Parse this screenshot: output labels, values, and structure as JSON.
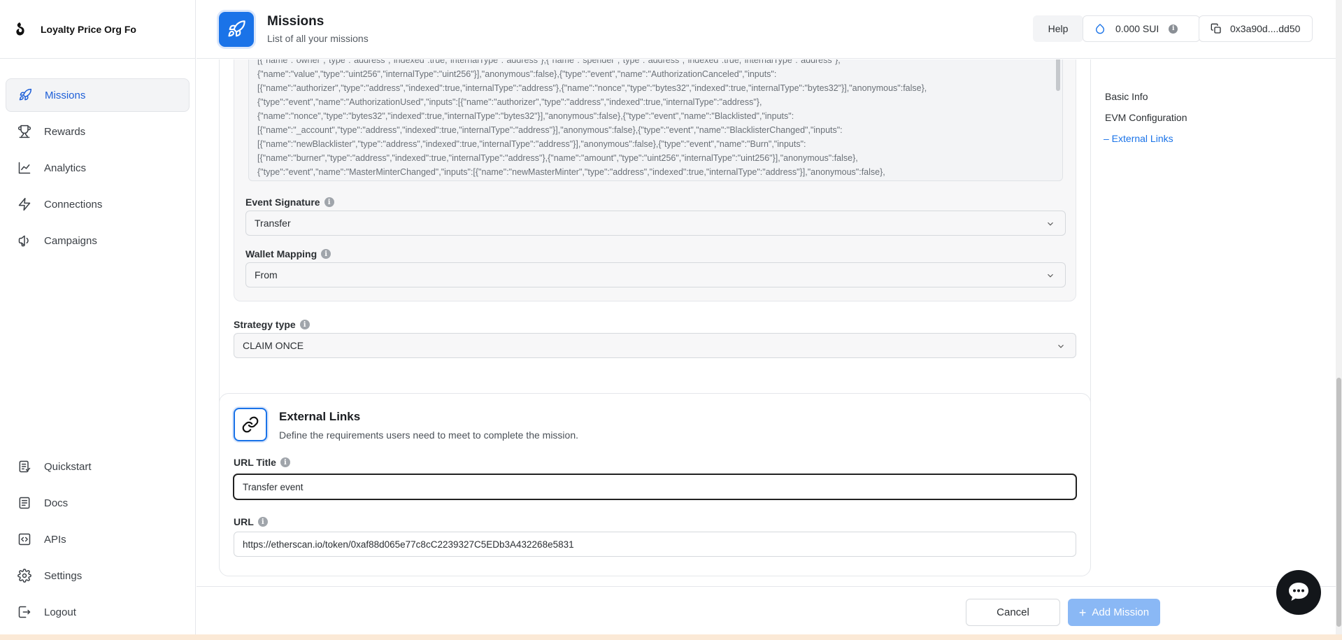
{
  "brand": {
    "name": "Loyalty Price Org Fo"
  },
  "nav": {
    "items": [
      {
        "label": "Missions",
        "icon": "rocket-icon",
        "active": true
      },
      {
        "label": "Rewards",
        "icon": "trophy-icon"
      },
      {
        "label": "Analytics",
        "icon": "chart-line-icon"
      },
      {
        "label": "Connections",
        "icon": "lightning-icon"
      },
      {
        "label": "Campaigns",
        "icon": "megaphone-icon"
      }
    ],
    "bottom": [
      {
        "label": "Quickstart",
        "icon": "checklist-icon"
      },
      {
        "label": "Docs",
        "icon": "document-icon"
      },
      {
        "label": "APIs",
        "icon": "code-icon"
      },
      {
        "label": "Settings",
        "icon": "gear-icon"
      },
      {
        "label": "Logout",
        "icon": "logout-icon"
      }
    ]
  },
  "header": {
    "title": "Missions",
    "subtitle": "List of all your missions",
    "help": "Help",
    "balance": "0.000 SUI",
    "address": "0x3a90d....dd50"
  },
  "abi": {
    "text": "[{\"name\":\"owner\",\"type\":\"address\",\"indexed\":true,\"internalType\":\"address\"},{\"name\":\"spender\",\"type\":\"address\",\"indexed\":true,\"internalType\":\"address\"},\n{\"name\":\"value\",\"type\":\"uint256\",\"internalType\":\"uint256\"}],\"anonymous\":false},{\"type\":\"event\",\"name\":\"AuthorizationCanceled\",\"inputs\":\n[{\"name\":\"authorizer\",\"type\":\"address\",\"indexed\":true,\"internalType\":\"address\"},{\"name\":\"nonce\",\"type\":\"bytes32\",\"indexed\":true,\"internalType\":\"bytes32\"}],\"anonymous\":false},\n{\"type\":\"event\",\"name\":\"AuthorizationUsed\",\"inputs\":[{\"name\":\"authorizer\",\"type\":\"address\",\"indexed\":true,\"internalType\":\"address\"},\n{\"name\":\"nonce\",\"type\":\"bytes32\",\"indexed\":true,\"internalType\":\"bytes32\"}],\"anonymous\":false},{\"type\":\"event\",\"name\":\"Blacklisted\",\"inputs\":\n[{\"name\":\"_account\",\"type\":\"address\",\"indexed\":true,\"internalType\":\"address\"}],\"anonymous\":false},{\"type\":\"event\",\"name\":\"BlacklisterChanged\",\"inputs\":\n[{\"name\":\"newBlacklister\",\"type\":\"address\",\"indexed\":true,\"internalType\":\"address\"}],\"anonymous\":false},{\"type\":\"event\",\"name\":\"Burn\",\"inputs\":\n[{\"name\":\"burner\",\"type\":\"address\",\"indexed\":true,\"internalType\":\"address\"},{\"name\":\"amount\",\"type\":\"uint256\",\"internalType\":\"uint256\"}],\"anonymous\":false},\n{\"type\":\"event\",\"name\":\"MasterMinterChanged\",\"inputs\":[{\"name\":\"newMasterMinter\",\"type\":\"address\",\"indexed\":true,\"internalType\":\"address\"}],\"anonymous\":false},\n{\"type\":\"event\",\"name\":\"Mint\",\"inputs\":[{\"name\":\"minter\",\"type\":\"address\",\"indexed\":true,\"internalType\":\"address\"},"
  },
  "event_signature": {
    "label": "Event Signature",
    "value": "Transfer"
  },
  "wallet_mapping": {
    "label": "Wallet Mapping",
    "value": "From"
  },
  "strategy": {
    "label": "Strategy type",
    "value": "CLAIM ONCE"
  },
  "external_links": {
    "title": "External Links",
    "subtitle": "Define the requirements users need to meet to complete the mission.",
    "url_title_label": "URL Title",
    "url_title_value": "Transfer event",
    "url_label": "URL",
    "url_value": "https://etherscan.io/token/0xaf88d065e77c8cC2239327C5EDb3A432268e5831"
  },
  "toc": {
    "items": [
      "Basic Info",
      "EVM Configuration",
      "– External Links"
    ]
  },
  "footer": {
    "cancel": "Cancel",
    "add": "Add Mission"
  },
  "colors": {
    "accent": "#1a73e8",
    "accent_disabled": "#8ab8f5"
  }
}
